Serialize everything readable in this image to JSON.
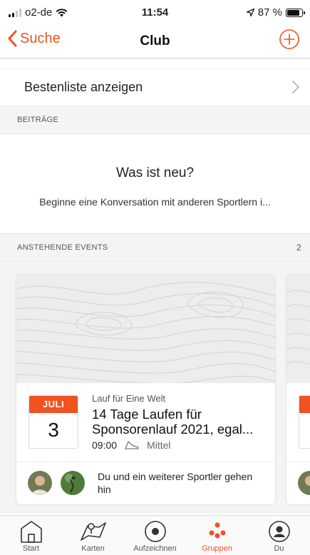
{
  "status_bar": {
    "carrier": "o2-de",
    "time": "11:54",
    "battery": "87 %",
    "battery_level": 0.87
  },
  "nav": {
    "back_label": "Suche",
    "title": "Club"
  },
  "leaderboard_label": "Bestenliste anzeigen",
  "posts": {
    "header": "BEITRÄGE",
    "title": "Was ist neu?",
    "subtitle": "Beginne eine Konversation mit anderen Sportlern i..."
  },
  "events": {
    "header": "ANSTEHENDE EVENTS",
    "count": "2",
    "items": [
      {
        "month": "JULI",
        "day": "3",
        "organizer": "Lauf für Eine Welt",
        "name": "14 Tage Laufen für Sponsorenlauf 2021, egal...",
        "time": "09:00",
        "level": "Mittel",
        "attendees": "Du und ein weiterer Sportler gehen hin"
      }
    ]
  },
  "tabs": [
    {
      "label": "Start",
      "icon": "home-icon"
    },
    {
      "label": "Karten",
      "icon": "map-icon"
    },
    {
      "label": "Aufzeichnen",
      "icon": "record-icon"
    },
    {
      "label": "Gruppen",
      "icon": "groups-icon",
      "active": true
    },
    {
      "label": "Du",
      "icon": "profile-icon"
    }
  ],
  "colors": {
    "accent": "#f05222",
    "section_bg": "#f4f4f4"
  }
}
